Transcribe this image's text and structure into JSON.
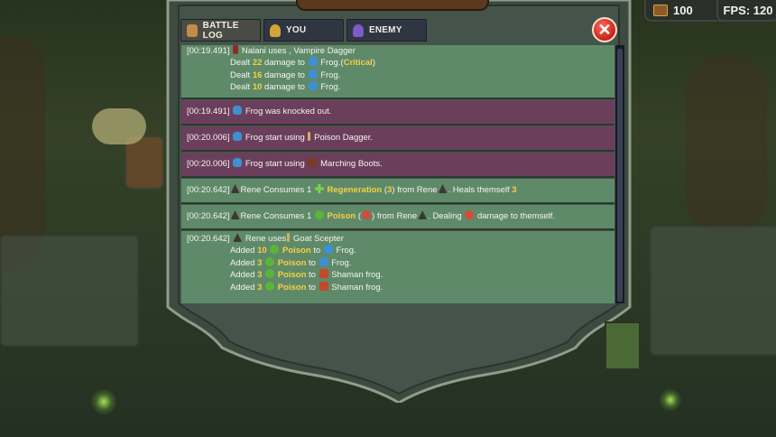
{
  "hud": {
    "gold": "100",
    "fps": "FPS: 120"
  },
  "tabs": [
    {
      "label": "BATTLE LOG",
      "icon": "scroll-icon",
      "color": "#c48a4a"
    },
    {
      "label": "YOU",
      "icon": "helmet-icon",
      "color": "#d4a43a"
    },
    {
      "label": "ENEMY",
      "icon": "purple-helmet-icon",
      "color": "#7b5cc9"
    }
  ],
  "close": {
    "label": "✕"
  },
  "log": {
    "e1": {
      "ts": "[00:19.491]",
      "actor": "Nalani uses",
      "sep": ",",
      "item": "Vampire Dagger",
      "l1": {
        "pre": "Dealt",
        "num": "22",
        "mid": "damage to",
        "target": "Frog.",
        "open": "(",
        "crit": "Critical",
        "close": ")"
      },
      "l2": {
        "pre": "Dealt",
        "num": "16",
        "mid": "damage to",
        "target": "Frog."
      },
      "l3": {
        "pre": "Dealt",
        "num": "10",
        "mid": "damage to",
        "target": "Frog."
      }
    },
    "e2": {
      "ts": "[00:19.491]",
      "text": "Frog was knocked out."
    },
    "e3": {
      "ts": "[00:20.006]",
      "text": "Frog start using",
      "item": "Poison Dagger."
    },
    "e4": {
      "ts": "[00:20.006]",
      "text": "Frog start using",
      "item": "Marching Boots."
    },
    "e5": {
      "ts": "[00:20.642]",
      "text": "Rene Consumes 1",
      "effect": "Regeneration",
      "paren_open": "(",
      "amount": "3",
      "paren_close": ")",
      "from": "from Rene",
      "tail": ". Heals themself",
      "heal": "3"
    },
    "e6": {
      "ts": "[00:20.642]",
      "text": "Rene Consumes 1",
      "effect": "Poison",
      "paren_open": "(",
      "paren_close": ")",
      "from": "from Rene",
      "tail": ". Dealing",
      "tail2": "damage to themself."
    },
    "e7": {
      "ts": "[00:20.642]",
      "text": "Rene uses",
      "item": "Goat Scepter",
      "adds": [
        {
          "pre": "Added",
          "num": "10",
          "eff": "Poison",
          "to": "to",
          "target": "Frog."
        },
        {
          "pre": "Added",
          "num": "3",
          "eff": "Poison",
          "to": "to",
          "target": "Frog."
        },
        {
          "pre": "Added",
          "num": "3",
          "eff": "Poison",
          "to": "to",
          "target": "Shaman frog."
        },
        {
          "pre": "Added",
          "num": "3",
          "eff": "Poison",
          "to": "to",
          "target": "Shaman frog."
        }
      ]
    }
  },
  "colors": {
    "green_row": "#5f8a69",
    "purple_row": "#6b3f5c",
    "highlight": "#f3d046",
    "close_red": "#c9201b"
  }
}
